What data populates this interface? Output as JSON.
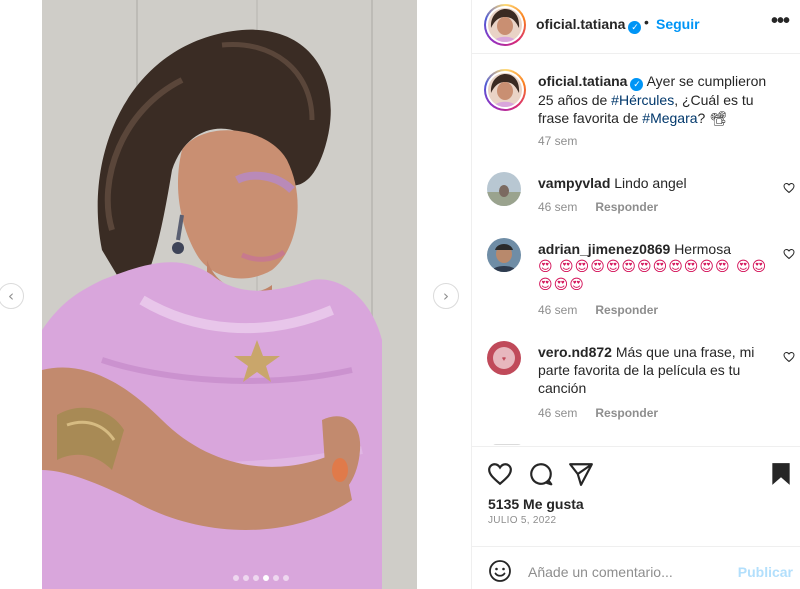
{
  "post": {
    "carousel": {
      "total_slides": 6,
      "active_slide": 4
    }
  },
  "header": {
    "username": "oficial.tatiana",
    "bullet": "•",
    "follow_label": "Seguir",
    "more_icon": "more-horizontal-icon"
  },
  "caption": {
    "username": "oficial.tatiana",
    "text_before": " Ayer se cumplieron 25 años de ",
    "hashtag1": "#Hércules",
    "text_middle": ", ¿Cuál es tu frase favorita de ",
    "hashtag2": "#Megara",
    "text_after": "? ",
    "emoji": "📽",
    "time": "47 sem"
  },
  "comments": [
    {
      "username": "vampyvlad",
      "text": "Lindo angel",
      "time": "46 sem",
      "reply_label": "Responder"
    },
    {
      "username": "adrian_jimenez0869",
      "text": "Hermosa",
      "emojis": "😍 😍😍😍😍😍😍😍😍😍😍😍 😍😍😍😍😍",
      "time": "46 sem",
      "reply_label": "Responder"
    },
    {
      "username": "vero.nd872",
      "text": "Más que una frase, mi parte favorita de la película es tu canción",
      "time": "46 sem",
      "reply_label": "Responder"
    }
  ],
  "actions": {
    "likes": "5135 Me gusta",
    "date": "JULIO 5, 2022"
  },
  "comment_box": {
    "placeholder": "Añade un comentario...",
    "publish_label": "Publicar"
  },
  "colors": {
    "link_blue": "#0095f6",
    "hashtag": "#00376b",
    "muted": "#8e8e8e",
    "publish_disabled": "#b2dffc"
  }
}
